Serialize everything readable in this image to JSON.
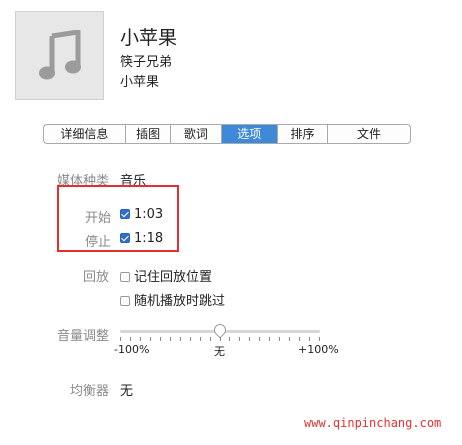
{
  "header": {
    "title": "小苹果",
    "artist": "筷子兄弟",
    "album": "小苹果",
    "artwork_icon": "music-note-icon"
  },
  "tabs": [
    {
      "label": "详细信息",
      "active": false
    },
    {
      "label": "插图",
      "active": false
    },
    {
      "label": "歌词",
      "active": false
    },
    {
      "label": "选项",
      "active": true
    },
    {
      "label": "排序",
      "active": false
    },
    {
      "label": "文件",
      "active": false
    }
  ],
  "options": {
    "media_kind_label": "媒体种类",
    "media_kind_value": "音乐",
    "start_label": "开始",
    "start_checked": true,
    "start_value": "1:03",
    "stop_label": "停止",
    "stop_checked": true,
    "stop_value": "1:18",
    "playback_label": "回放",
    "remember_position_label": "记住回放位置",
    "remember_position_checked": false,
    "skip_shuffle_label": "随机播放时跳过",
    "skip_shuffle_checked": false,
    "volume_label": "音量调整",
    "volume_min_label": "-100%",
    "volume_mid_label": "无",
    "volume_max_label": "+100%",
    "volume_value_percent": 0,
    "equalizer_label": "均衡器",
    "equalizer_value": "无"
  },
  "watermark": "www.qinpinchang.com",
  "colors": {
    "active_tab": "#3f8ad8",
    "highlight_box": "#e23030",
    "watermark": "#e23232"
  }
}
